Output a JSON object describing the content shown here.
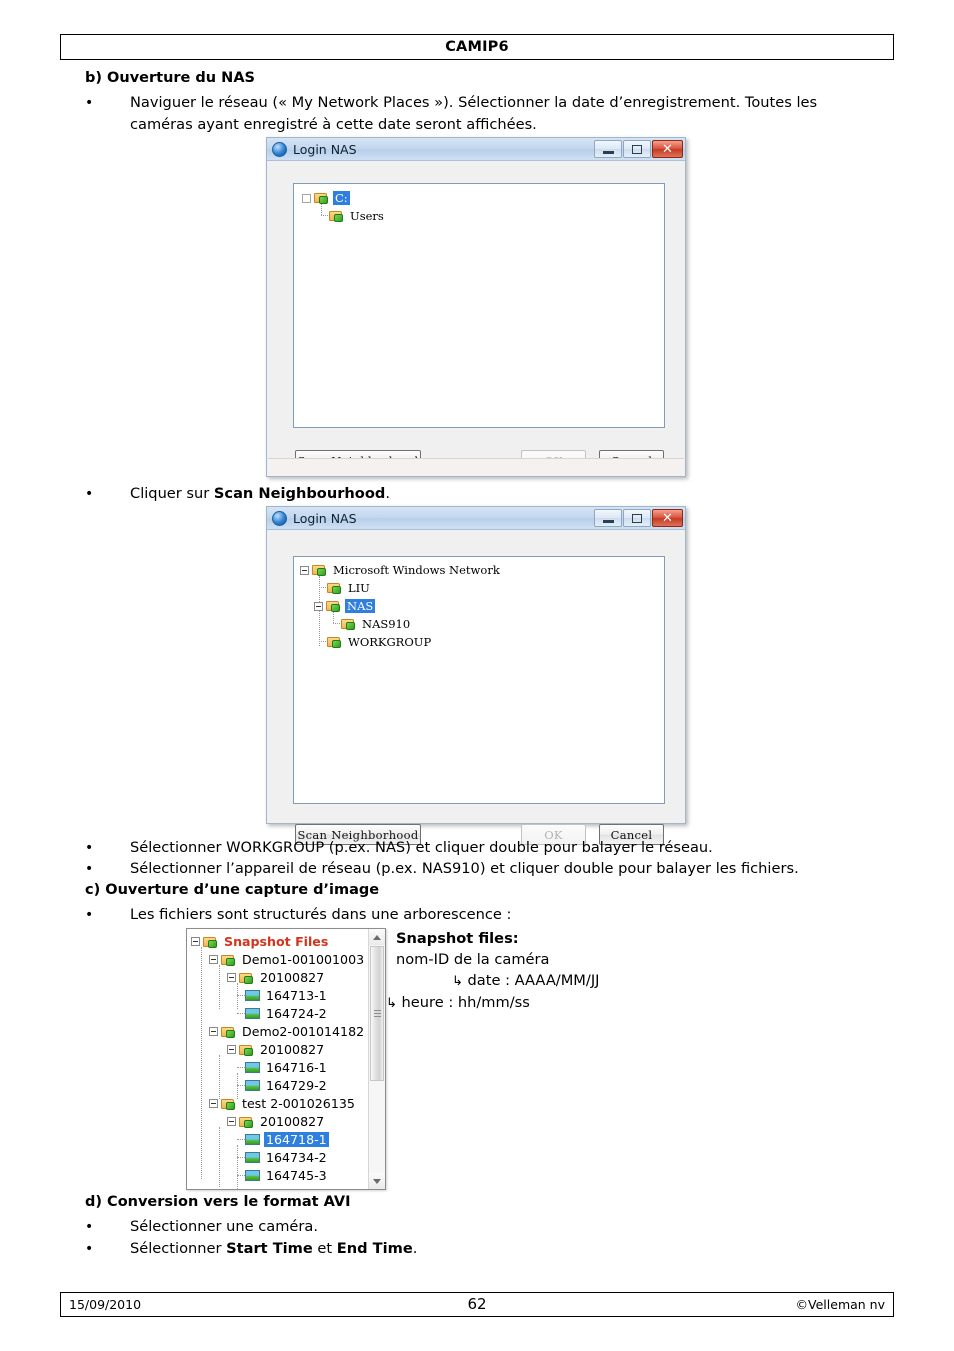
{
  "header": {
    "title": "CAMIP6"
  },
  "sections": {
    "b_heading": "b) Ouverture du NAS",
    "b_bullet1": "Naviguer le réseau (« My Network Places »). Sélectionner la date d’enregistrement. Toutes les caméras ayant enregistré à cette date seront affichées.",
    "b_bullet2_pre": "Cliquer sur ",
    "b_bullet2_bold": "Scan Neighbourhood",
    "b_bullet2_post": ".",
    "b_bullet3": "Sélectionner WORKGROUP (p.ex. NAS) et cliquer double pour balayer le réseau.",
    "b_bullet4": "Sélectionner l’appareil de réseau (p.ex. NAS910) et cliquer double pour balayer les fichiers.",
    "c_heading": "c) Ouverture d’une capture d’image",
    "c_bullet1": "Les fichiers sont structurés dans une arborescence :",
    "d_heading": "d) Conversion vers le format AVI",
    "d_bullet1": "Sélectionner une caméra.",
    "d_bullet2_pre": "Sélectionner ",
    "d_bullet2_bold1": "Start Time",
    "d_bullet2_mid": " et ",
    "d_bullet2_bold2": "End Time",
    "d_bullet2_post": "."
  },
  "dialog1": {
    "title": "Login NAS",
    "icon": "globe-icon",
    "window_buttons": {
      "minimize": "minimize-icon",
      "maximize": "maximize-icon",
      "close": "✕"
    },
    "tree": [
      {
        "label": "C:",
        "selected": true,
        "expander": "blank",
        "indent": 0
      },
      {
        "label": "Users",
        "selected": false,
        "expander": "none",
        "indent": 1
      }
    ],
    "buttons": {
      "scan": "Scan Neighborhood",
      "ok": "OK",
      "cancel": "Cancel"
    },
    "ok_disabled": true
  },
  "dialog2": {
    "title": "Login NAS",
    "icon": "globe-icon",
    "window_buttons": {
      "minimize": "minimize-icon",
      "maximize": "maximize-icon",
      "close": "✕"
    },
    "tree": [
      {
        "label": "Microsoft Windows Network",
        "selected": false,
        "expander": "minus",
        "indent": 0
      },
      {
        "label": "LIU",
        "selected": false,
        "expander": "none",
        "indent": 1
      },
      {
        "label": "NAS",
        "selected": true,
        "expander": "minus",
        "indent": 1
      },
      {
        "label": "NAS910",
        "selected": false,
        "expander": "none",
        "indent": 2
      },
      {
        "label": "WORKGROUP",
        "selected": false,
        "expander": "none",
        "indent": 1
      }
    ],
    "buttons": {
      "scan": "Scan Neighborhood",
      "ok": "OK",
      "cancel": "Cancel"
    },
    "ok_disabled": true
  },
  "snapshot_tree": {
    "nodes": [
      {
        "label": "Snapshot Files",
        "type": "folder",
        "indent": 0,
        "expander": "minus",
        "style": "red",
        "selected": false
      },
      {
        "label": "Demo1-001001003",
        "type": "folder",
        "indent": 1,
        "expander": "minus",
        "style": "",
        "selected": false
      },
      {
        "label": "20100827",
        "type": "folder",
        "indent": 2,
        "expander": "minus",
        "style": "",
        "selected": false
      },
      {
        "label": "164713-1",
        "type": "image",
        "indent": 3,
        "expander": "none",
        "style": "",
        "selected": false
      },
      {
        "label": "164724-2",
        "type": "image",
        "indent": 3,
        "expander": "none",
        "style": "",
        "selected": false
      },
      {
        "label": "Demo2-001014182",
        "type": "folder",
        "indent": 1,
        "expander": "minus",
        "style": "",
        "selected": false
      },
      {
        "label": "20100827",
        "type": "folder",
        "indent": 2,
        "expander": "minus",
        "style": "",
        "selected": false
      },
      {
        "label": "164716-1",
        "type": "image",
        "indent": 3,
        "expander": "none",
        "style": "",
        "selected": false
      },
      {
        "label": "164729-2",
        "type": "image",
        "indent": 3,
        "expander": "none",
        "style": "",
        "selected": false
      },
      {
        "label": "test 2-001026135",
        "type": "folder",
        "indent": 1,
        "expander": "minus",
        "style": "",
        "selected": false
      },
      {
        "label": "20100827",
        "type": "folder",
        "indent": 2,
        "expander": "minus",
        "style": "",
        "selected": false
      },
      {
        "label": "164718-1",
        "type": "image",
        "indent": 3,
        "expander": "none",
        "style": "",
        "selected": true
      },
      {
        "label": "164734-2",
        "type": "image",
        "indent": 3,
        "expander": "none",
        "style": "",
        "selected": false
      },
      {
        "label": "164745-3",
        "type": "image",
        "indent": 3,
        "expander": "none",
        "style": "",
        "selected": false
      }
    ],
    "scrollbar": {
      "up": "▲",
      "down": "▼"
    }
  },
  "legend": {
    "title": "Snapshot files:",
    "line1": "nom-ID de la caméra",
    "line2_arrow": "↳",
    "line2": "date : AAAA/MM/JJ",
    "line3_arrow": "↳",
    "line3": "heure : hh/mm/ss"
  },
  "footer": {
    "date": "15/09/2010",
    "page": "62",
    "copyright": "©Velleman nv"
  },
  "colors": {
    "accent_red": "#d2341c",
    "selection_blue": "#2f7fe0",
    "titlebar_blue": "#c3d7ef",
    "close_red": "#c23b22"
  }
}
